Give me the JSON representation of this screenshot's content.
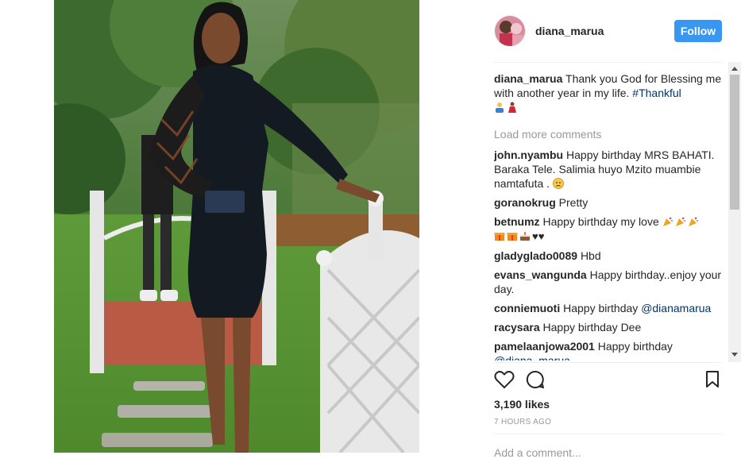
{
  "post": {
    "username": "diana_marua",
    "follow_label": "Follow",
    "caption_user": "diana_marua",
    "caption_text": "Thank you God for Blessing me with another year in my life.",
    "caption_hashtag": "#Thankful",
    "load_more": "Load more comments",
    "likes": "3,190 likes",
    "time": "7 HOURS AGO",
    "add_comment_placeholder": "Add a comment..."
  },
  "comments": [
    {
      "user": "john.nyambu",
      "text": "Happy birthday MRS BAHATI. Baraka Tele. Salimia huyo Mzito muambie namtafuta ."
    },
    {
      "user": "goranokrug",
      "text": "Pretty"
    },
    {
      "user": "betnumz",
      "text": "Happy birthday my love"
    },
    {
      "user": "gladyglado0089",
      "text": "Hbd"
    },
    {
      "user": "evans_wangunda",
      "text": "Happy birthday..enjoy your day."
    },
    {
      "user": "conniemuoti",
      "text": "Happy birthday",
      "mention": "@dianamarua"
    },
    {
      "user": "racysara",
      "text": "Happy birthday Dee"
    },
    {
      "user": "pamelaanjowa2001",
      "text": "Happy birthday",
      "mention": "@diana_marua"
    }
  ],
  "colors": {
    "follow_button": "#3897f0",
    "link": "#003569",
    "muted": "#999999"
  },
  "icons": {
    "like": "heart-icon",
    "comment": "speech-bubble-icon",
    "save": "bookmark-icon"
  }
}
